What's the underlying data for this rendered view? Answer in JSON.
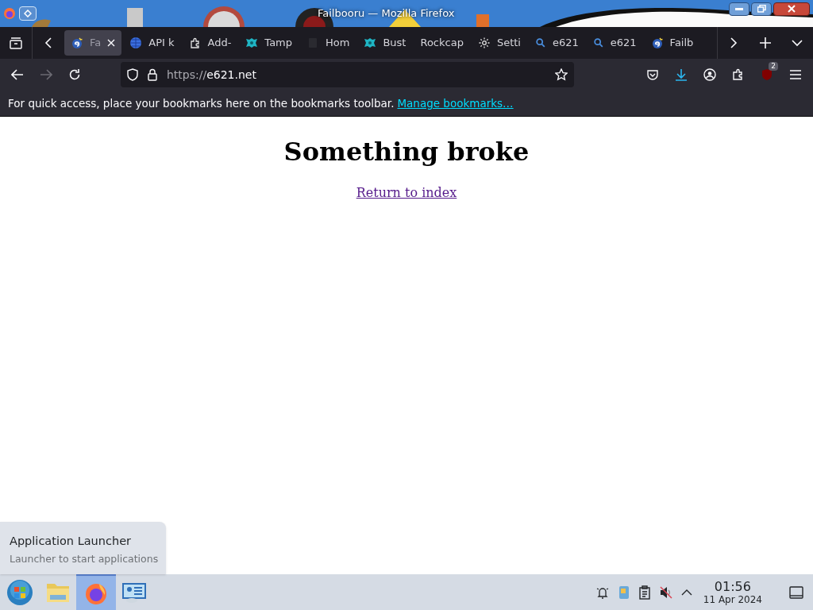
{
  "window": {
    "title": "Failbooru — Mozilla Firefox"
  },
  "tabs": [
    {
      "label": "Fa",
      "kind": "site",
      "selected": true
    },
    {
      "label": "API k",
      "kind": "globe",
      "selected": false
    },
    {
      "label": "Add-",
      "kind": "puzzle",
      "selected": false
    },
    {
      "label": "Tamp",
      "kind": "monkey",
      "selected": false
    },
    {
      "label": "Hom",
      "kind": "blank",
      "selected": false
    },
    {
      "label": "Bust",
      "kind": "monkey",
      "selected": false
    },
    {
      "label": "Rockcap",
      "kind": "plain",
      "selected": false
    },
    {
      "label": "Setti",
      "kind": "gear",
      "selected": false
    },
    {
      "label": "e621",
      "kind": "search",
      "selected": false
    },
    {
      "label": "e621",
      "kind": "search",
      "selected": false
    },
    {
      "label": "Failb",
      "kind": "site",
      "selected": false
    }
  ],
  "address": {
    "scheme": "https://",
    "host": "e621.net"
  },
  "toolbar": {
    "forward_disabled": true,
    "extension_badge": "2"
  },
  "bookmarks_bar": {
    "message": "For quick access, place your bookmarks here on the bookmarks toolbar.",
    "link": "Manage bookmarks…"
  },
  "page": {
    "heading": "Something broke",
    "link": "Return to index"
  },
  "tooltip": {
    "title": "Application Launcher",
    "subtitle": "Launcher to start applications"
  },
  "taskbar": {
    "apps": [
      {
        "kind": "start",
        "selected": false
      },
      {
        "kind": "folder",
        "selected": false
      },
      {
        "kind": "firefox",
        "selected": true
      },
      {
        "kind": "remote",
        "selected": false
      }
    ],
    "clock": {
      "time": "01:56",
      "date": "11 Apr 2024"
    }
  }
}
